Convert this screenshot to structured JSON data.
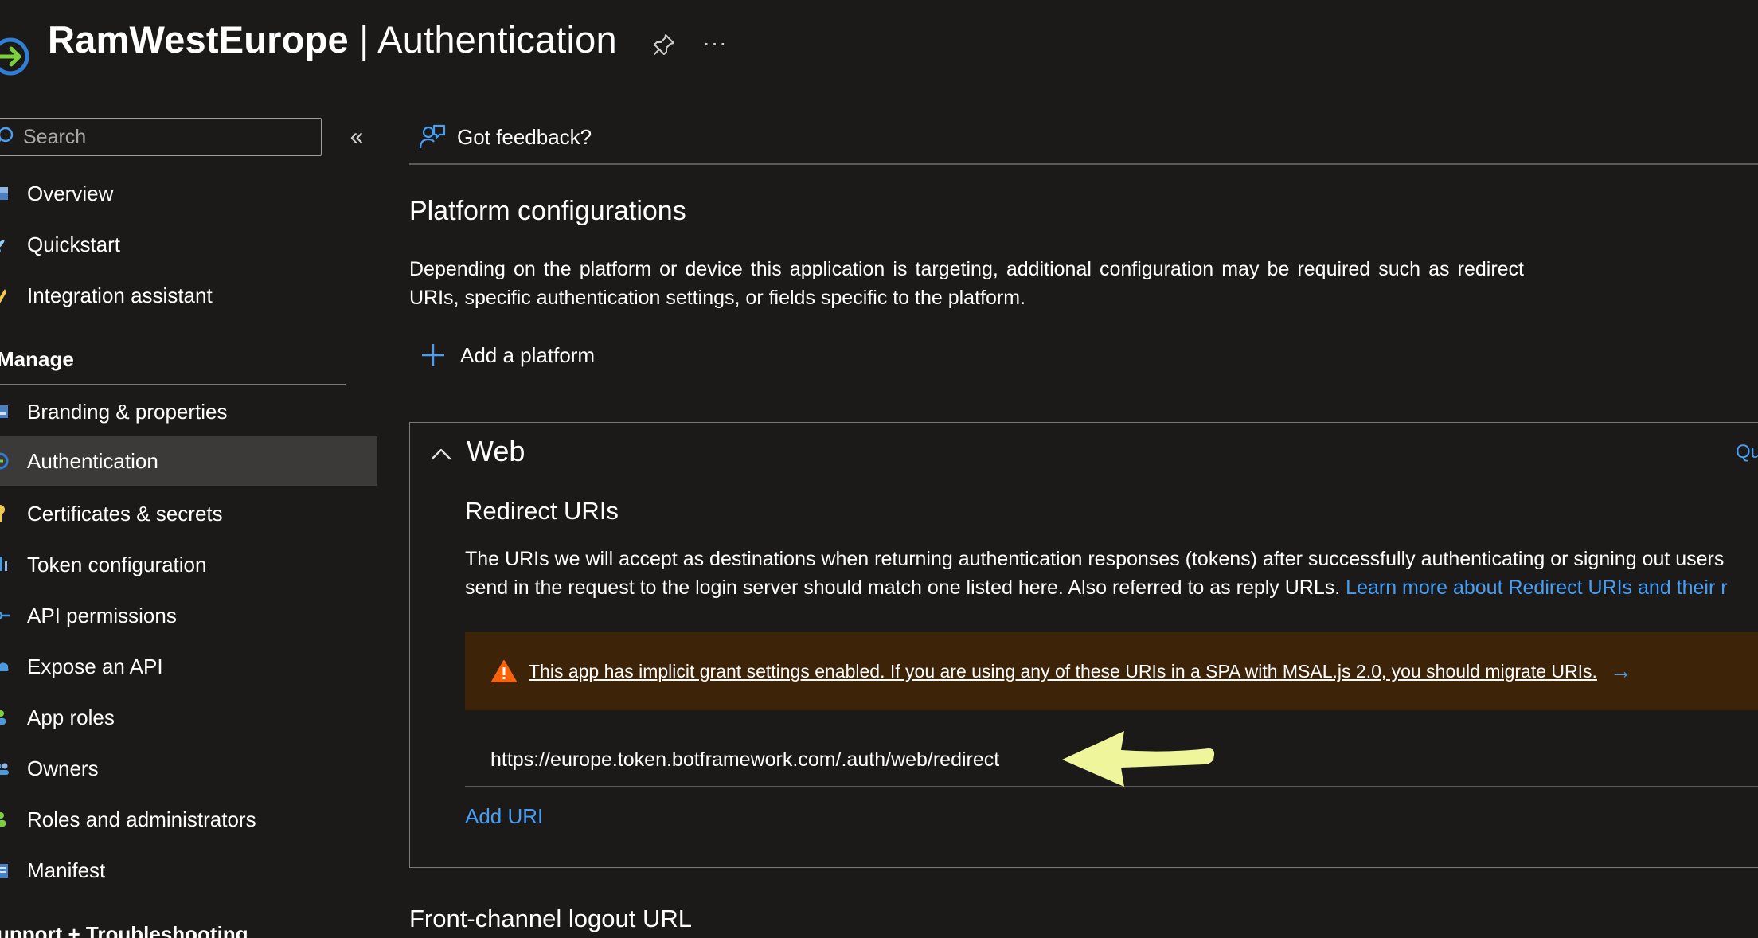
{
  "header": {
    "resource_name": "RamWestEurope",
    "separator": " | ",
    "blade_name": "Authentication",
    "more_label": "···"
  },
  "sidebar": {
    "search_placeholder": "Search",
    "collapse_label": "«",
    "items_top": [
      {
        "label": "Overview",
        "icon": "overview-icon"
      },
      {
        "label": "Quickstart",
        "icon": "quickstart-icon"
      },
      {
        "label": "Integration assistant",
        "icon": "rocket-icon"
      }
    ],
    "manage_heading": "Manage",
    "items_manage": [
      {
        "label": "Branding & properties",
        "icon": "branding-icon"
      },
      {
        "label": "Authentication",
        "icon": "authentication-icon",
        "active": true
      },
      {
        "label": "Certificates & secrets",
        "icon": "key-icon"
      },
      {
        "label": "Token configuration",
        "icon": "token-icon"
      },
      {
        "label": "API permissions",
        "icon": "api-permissions-icon"
      },
      {
        "label": "Expose an API",
        "icon": "cloud-icon"
      },
      {
        "label": "App roles",
        "icon": "app-roles-icon"
      },
      {
        "label": "Owners",
        "icon": "owners-icon"
      },
      {
        "label": "Roles and administrators",
        "icon": "roles-icon"
      },
      {
        "label": "Manifest",
        "icon": "manifest-icon"
      }
    ],
    "support_heading": "upport + Troubleshooting"
  },
  "main": {
    "feedback_label": "Got feedback?",
    "platform_heading": "Platform configurations",
    "platform_description": "Depending on the platform or device this application is targeting, additional configuration may be required such as redirect URIs, specific authentication settings, or fields specific to the platform.",
    "add_platform_label": "Add a platform",
    "web": {
      "title": "Web",
      "quickstart_fragment": "Qu",
      "redirect_heading": "Redirect URIs",
      "redirect_desc_line1": "The URIs we will accept as destinations when returning authentication responses (tokens) after successfully authenticating or signing out users",
      "redirect_desc_line2": "send in the request to the login server should match one listed here. Also referred to as reply URLs.",
      "redirect_learn_more": "Learn more about Redirect URIs and their r",
      "warning_text": "This app has implicit grant settings enabled. If you are using any of these URIs in a SPA with MSAL.js 2.0, you should migrate URIs.",
      "warning_arrow": "→",
      "redirect_uris": [
        "https://europe.token.botframework.com/.auth/web/redirect"
      ],
      "add_uri_label": "Add URI"
    },
    "front_channel_heading": "Front-channel logout URL"
  },
  "colors": {
    "background": "#1b1a19",
    "accent_link": "#479ef5",
    "active_nav": "#3b3a39",
    "warning_bg": "#3d2409",
    "warning_icon": "#f7630c",
    "annotation_arrow": "#eef59a"
  }
}
